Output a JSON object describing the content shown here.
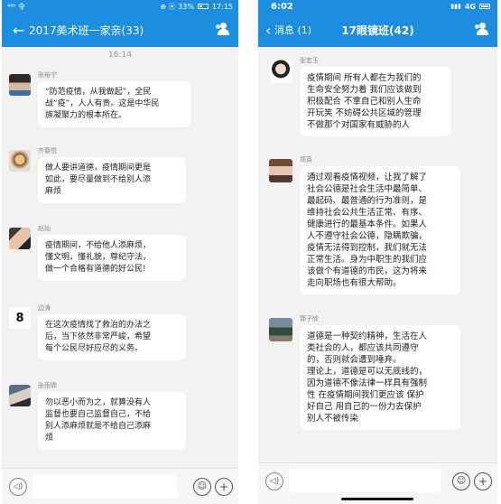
{
  "left": {
    "status": {
      "carrier": "⁴⁶ᴵⁱ 令",
      "right": "⊕ ⦿ 33%",
      "time": "17:15"
    },
    "title": "2017美术班一家亲(33)",
    "time_divider": "16:14",
    "messages": [
      {
        "name": "张裕宁",
        "lines": [
          "“防范疫情，从我做起”，全民",
          "战“疫”，人人有责。这是中华民",
          "族凝聚力的根本所在。"
        ]
      },
      {
        "name": "齐春悦",
        "lines": [
          "做人要讲道德，疫情期间更是",
          "如此，要尽量做到不给别人添",
          "麻烦"
        ]
      },
      {
        "name": "赵灿",
        "lines": [
          "疫情期间，不给他人添麻烦，",
          "懂文明，懂礼貌，尊纪守法，",
          "做一个合格有道德的好公民!"
        ]
      },
      {
        "name": "边涛",
        "lines": [
          "在这次疫情找了救治的办法之",
          "后，当下依然非常严峻，希望",
          "每个公民尽好应尽的义务。"
        ]
      },
      {
        "name": "张雨霏",
        "lines": [
          "勿以恶小而为之，就算没有人",
          "监督也要自己监督自己，不给",
          "别人添麻烦就是不给自己添麻",
          "烦"
        ]
      }
    ]
  },
  "right": {
    "status": {
      "time": "6:02",
      "network": "4G"
    },
    "back_label": "消息 (1)",
    "title": "17眼镜班(42)",
    "messages": [
      {
        "name": "张宏玉",
        "lines": [
          "疫情期间 所有人都在为我们的",
          "生命安全努力着  我们应该做到",
          "积极配合 不拿自己和别人生命",
          "开玩笑 不妨碍公共区域的管理",
          "不做那个对国家有威胁的人"
        ]
      },
      {
        "name": "项英",
        "lines": [
          "通过观看疫情视频，让我了解了",
          "社会公德是社会生活中最简单、",
          "最起码、最普通的行为准则，是",
          "维持社会公共生活正常、有序、",
          "健康进行的最基本条件。如果人",
          "人不遵守社会公德，隐瞒欺骗，",
          "疫情无法得到控制，我们就无法",
          "正常生活。身为中职生的我们应",
          "该做个有道德的市民，这为将来",
          "走向职场也有很大帮助。"
        ]
      },
      {
        "name": "郭子欣",
        "lines": [
          "道德是一种契约精神，生活在人",
          "类社会的人，都应该共同遵守",
          "的，否则就会遭到唾弃。",
          "理论上，道德是可以无底线的，",
          "因为道德不像法律一样具有强制",
          "性 在疫情期间我们更应该 保护",
          "好自己 用自己的一份力去保护",
          "别人不被传染"
        ]
      }
    ]
  },
  "icons": {
    "back": "chevron-left-icon",
    "group": "group-members-icon",
    "voice": "voice-icon",
    "emoji": "emoji-icon",
    "plus": "plus-icon"
  }
}
